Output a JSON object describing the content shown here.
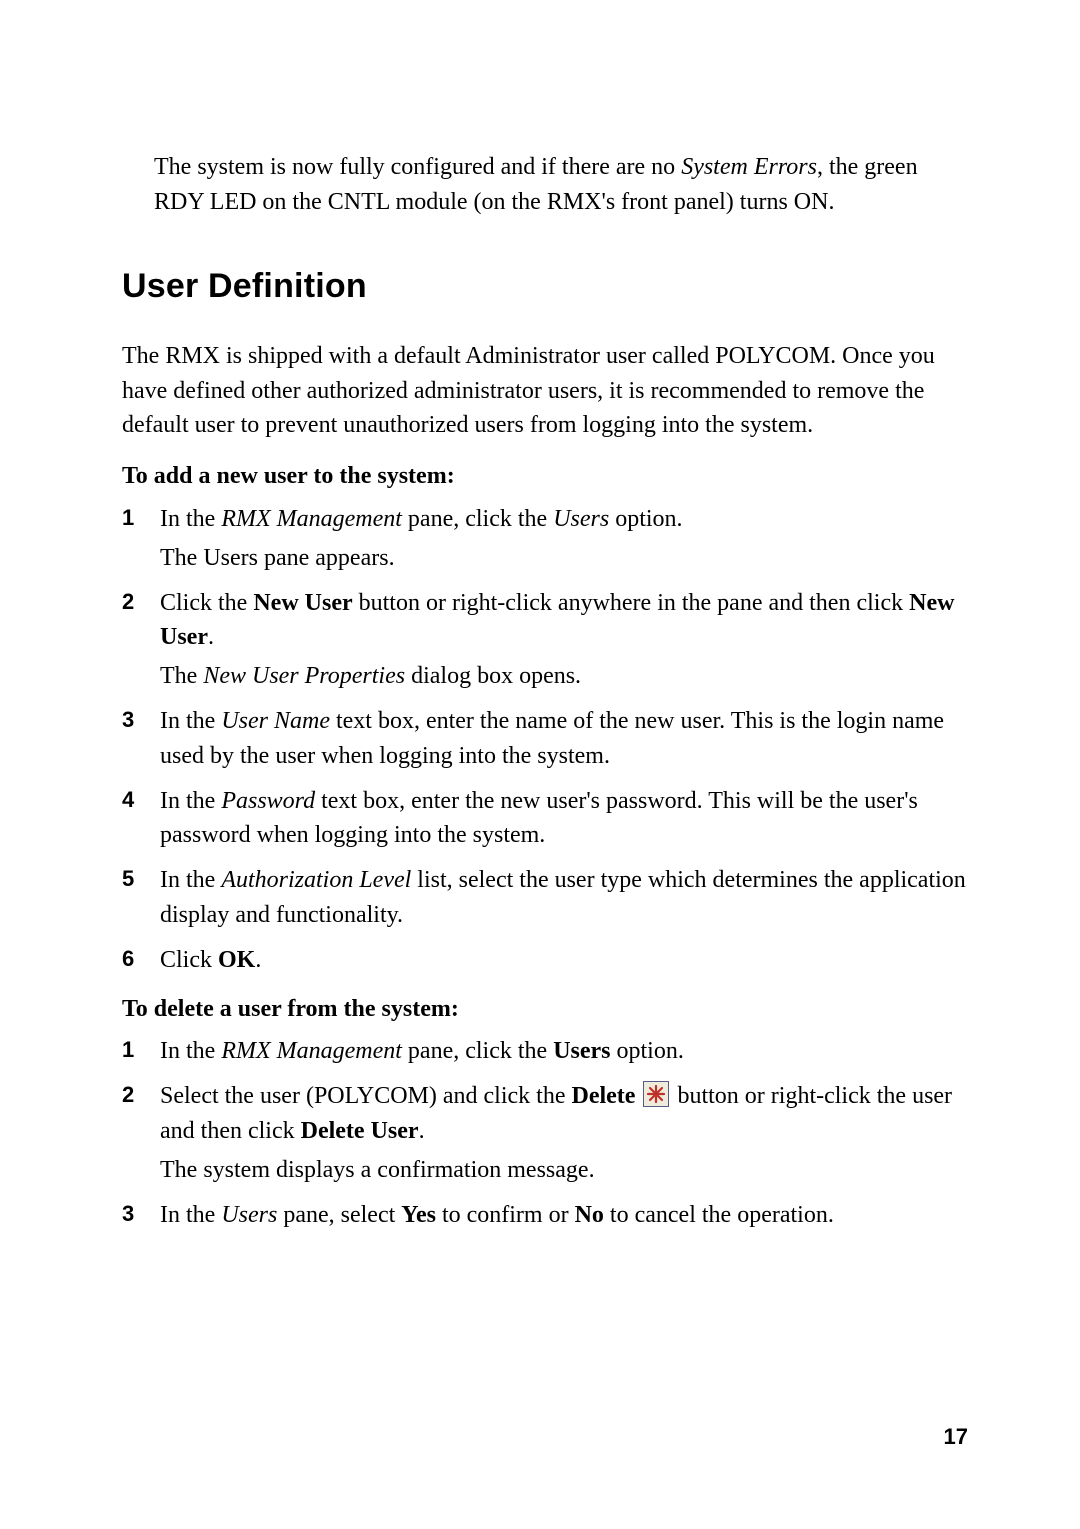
{
  "intro": {
    "text_before": "The system is now fully configured and if there are no ",
    "italic_term": "System Errors",
    "text_after": ", the green RDY LED on the CNTL module (on the RMX's front panel) turns ON."
  },
  "section": {
    "title": "User Definition",
    "body": "The RMX is shipped with a default Administrator user called POLYCOM. Once you have defined other authorized administrator users, it is recommended to remove the default user to prevent unauthorized users from logging into the system."
  },
  "add_user": {
    "heading": "To add a new user to the system:",
    "steps": [
      {
        "num": "1",
        "seg": [
          {
            "t": "In the "
          },
          {
            "t": "RMX Management",
            "i": true
          },
          {
            "t": " pane, click the "
          },
          {
            "t": "Users",
            "i": true
          },
          {
            "t": " option."
          }
        ],
        "follow": "The Users pane appears."
      },
      {
        "num": "2",
        "seg": [
          {
            "t": "Click the "
          },
          {
            "t": "New User",
            "b": true
          },
          {
            "t": " button or right-click anywhere in the pane and then click "
          },
          {
            "t": "New User",
            "b": true
          },
          {
            "t": "."
          }
        ],
        "follow_seg": [
          {
            "t": "The "
          },
          {
            "t": "New User Properties",
            "i": true
          },
          {
            "t": " dialog box opens."
          }
        ]
      },
      {
        "num": "3",
        "seg": [
          {
            "t": "In the "
          },
          {
            "t": "User Name",
            "i": true
          },
          {
            "t": " text box, enter the name of the new user. This is the login name used by the user when logging into the system."
          }
        ]
      },
      {
        "num": "4",
        "seg": [
          {
            "t": "In the "
          },
          {
            "t": "Password",
            "i": true
          },
          {
            "t": " text box, enter the new user's password. This will be the user's password when logging into the system."
          }
        ]
      },
      {
        "num": "5",
        "seg": [
          {
            "t": "In the "
          },
          {
            "t": "Authorization Level",
            "i": true
          },
          {
            "t": " list, select the user type which determines the application display and functionality."
          }
        ]
      },
      {
        "num": "6",
        "seg": [
          {
            "t": "Click "
          },
          {
            "t": "OK",
            "b": true
          },
          {
            "t": "."
          }
        ]
      }
    ]
  },
  "delete_user": {
    "heading": "To delete a user from the system:",
    "steps": [
      {
        "num": "1",
        "seg": [
          {
            "t": "In the "
          },
          {
            "t": "RMX Management",
            "i": true
          },
          {
            "t": " pane, click the "
          },
          {
            "t": "Users",
            "b": true
          },
          {
            "t": " option."
          }
        ]
      },
      {
        "num": "2",
        "seg": [
          {
            "t": "Select the user (POLYCOM) and click the "
          },
          {
            "t": "Delete",
            "b": true
          },
          {
            "t": " "
          },
          {
            "icon": "delete-icon"
          },
          {
            "t": " button or right-click the user and then click "
          },
          {
            "t": "Delete User",
            "b": true
          },
          {
            "t": "."
          }
        ],
        "follow": "The system displays a confirmation message."
      },
      {
        "num": "3",
        "seg": [
          {
            "t": "In the "
          },
          {
            "t": "Users",
            "i": true
          },
          {
            "t": " pane, select "
          },
          {
            "t": "Yes",
            "b": true
          },
          {
            "t": " to confirm or "
          },
          {
            "t": "No",
            "b": true
          },
          {
            "t": " to cancel the operation."
          }
        ]
      }
    ]
  },
  "page_number": "17"
}
